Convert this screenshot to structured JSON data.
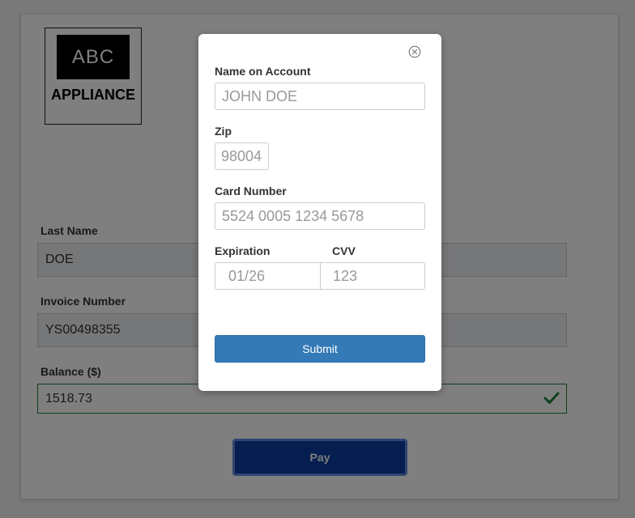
{
  "logo": {
    "top_text": "ABC",
    "bottom_text": "APPLIANCE"
  },
  "form": {
    "last_name": {
      "label": "Last Name",
      "value": "DOE"
    },
    "invoice_number": {
      "label": "Invoice Number",
      "value": "YS00498355"
    },
    "balance": {
      "label": "Balance ($)",
      "value": "1518.73"
    },
    "pay_label": "Pay"
  },
  "modal": {
    "name_on_account": {
      "label": "Name on Account",
      "placeholder": "JOHN DOE"
    },
    "zip": {
      "label": "Zip",
      "placeholder": "98004"
    },
    "card_number": {
      "label": "Card Number",
      "placeholder": "5524 0005 1234 5678"
    },
    "expiration": {
      "label": "Expiration",
      "placeholder": "01/26"
    },
    "cvv": {
      "label": "CVV",
      "placeholder": "123"
    },
    "submit_label": "Submit"
  },
  "icons": {
    "close": "close-icon",
    "valid": "check-icon"
  },
  "colors": {
    "pay_button": "#0a3d9e",
    "submit_button": "#337ab7",
    "valid_border": "#1e7e34",
    "overlay": "rgba(0,0,0,0.5)"
  }
}
